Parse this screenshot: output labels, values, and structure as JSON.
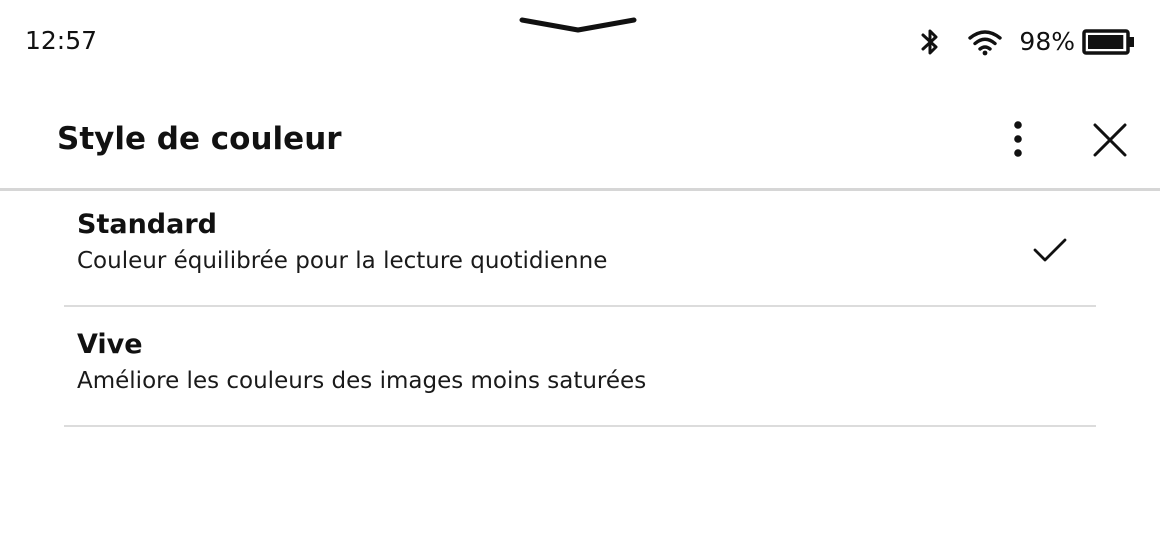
{
  "status_bar": {
    "time": "12:57",
    "battery_percent": "98%",
    "icons": [
      "pull-down-handle-icon",
      "bluetooth-icon",
      "wifi-icon",
      "battery-icon"
    ],
    "battery_level": 0.98
  },
  "header": {
    "title": "Style de couleur",
    "icons": [
      "more-vertical-icon",
      "close-icon"
    ]
  },
  "options": [
    {
      "name": "Standard",
      "description": "Couleur équilibrée pour la lecture quotidienne",
      "selected": true
    },
    {
      "name": "Vive",
      "description": "Améliore les couleurs des images moins saturées",
      "selected": false
    }
  ],
  "colors": {
    "text": "#111111",
    "divider": "#dcdcdc",
    "header_border": "#d6d6d6",
    "background": "#ffffff"
  }
}
